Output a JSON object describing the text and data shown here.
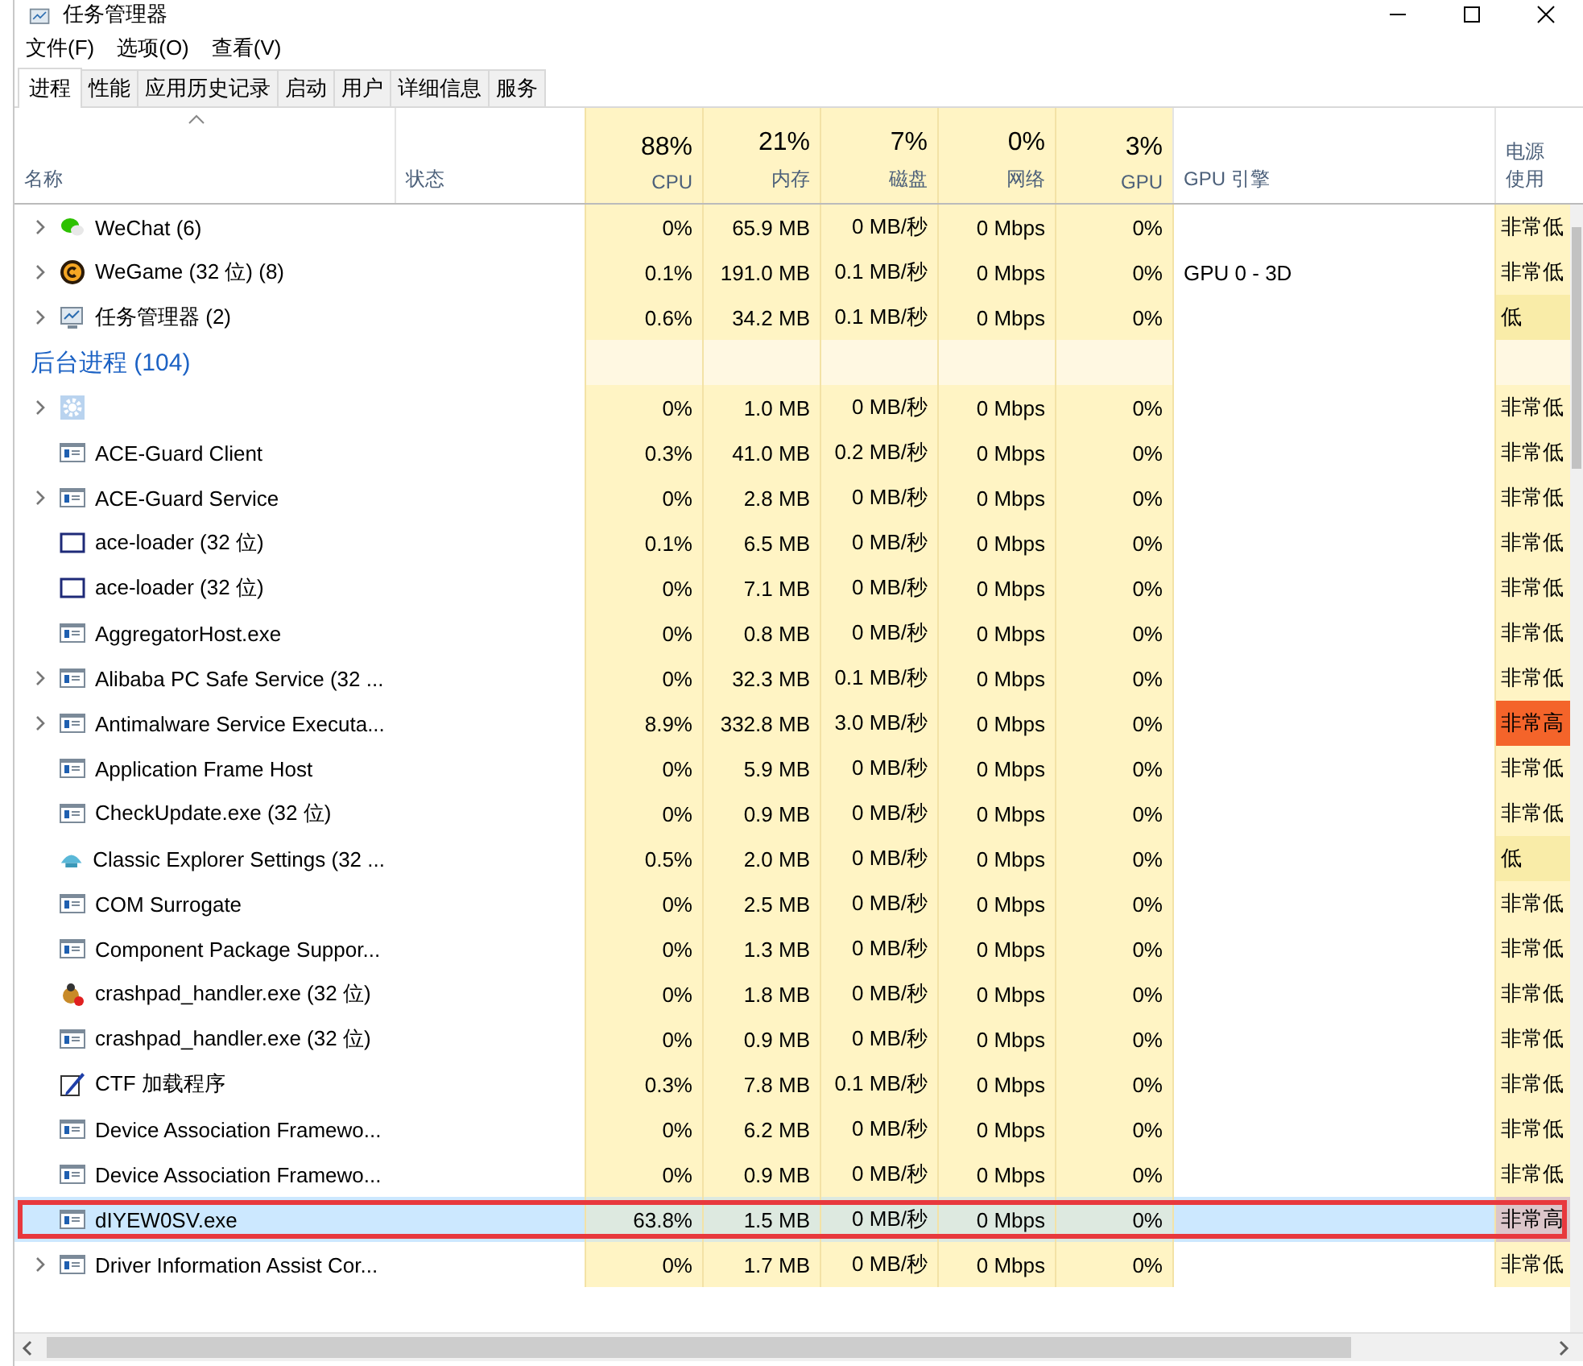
{
  "window": {
    "title": "任务管理器"
  },
  "menu": [
    "文件(F)",
    "选项(O)",
    "查看(V)"
  ],
  "tabs": [
    {
      "label": "进程",
      "selected": true
    },
    {
      "label": "性能",
      "selected": false
    },
    {
      "label": "应用历史记录",
      "selected": false
    },
    {
      "label": "启动",
      "selected": false
    },
    {
      "label": "用户",
      "selected": false
    },
    {
      "label": "详细信息",
      "selected": false
    },
    {
      "label": "服务",
      "selected": false
    }
  ],
  "columns": [
    {
      "label": "名称",
      "sorted": true
    },
    {
      "label": "状态"
    },
    {
      "total": "88%",
      "label": "CPU"
    },
    {
      "total": "21%",
      "label": "内存"
    },
    {
      "total": "7%",
      "label": "磁盘"
    },
    {
      "total": "0%",
      "label": "网络"
    },
    {
      "total": "3%",
      "label": "GPU"
    },
    {
      "label": "GPU 引擎"
    },
    {
      "label": "电源使用"
    }
  ],
  "rows": [
    {
      "kind": "chat",
      "name": "WeChat (6)",
      "expandable": true,
      "selected": false,
      "highlighted": false,
      "values": [
        "0%",
        "65.9 MB",
        "0 MB/秒",
        "0 Mbps",
        "0%"
      ],
      "gpu_engine": "",
      "power": {
        "text": "非常低",
        "color": "#fff4c4"
      }
    },
    {
      "kind": "game",
      "name": "WeGame (32 位) (8)",
      "expandable": true,
      "selected": false,
      "highlighted": false,
      "values": [
        "0.1%",
        "191.0 MB",
        "0.1 MB/秒",
        "0 Mbps",
        "0%"
      ],
      "gpu_engine": "GPU 0 - 3D",
      "power": {
        "text": "非常低",
        "color": "#fff4c4"
      }
    },
    {
      "kind": "monitor",
      "name": "任务管理器 (2)",
      "expandable": true,
      "selected": false,
      "highlighted": false,
      "values": [
        "0.6%",
        "34.2 MB",
        "0.1 MB/秒",
        "0 Mbps",
        "0%"
      ],
      "gpu_engine": "",
      "power": {
        "text": "低",
        "color": "#f9eca8"
      }
    },
    {
      "kind": "group",
      "name": "后台进程 (104)"
    },
    {
      "kind": "gear",
      "name": "",
      "expandable": true,
      "selected": false,
      "highlighted": false,
      "values": [
        "0%",
        "1.0 MB",
        "0 MB/秒",
        "0 Mbps",
        "0%"
      ],
      "gpu_engine": "",
      "power": {
        "text": "非常低",
        "color": "#fff4c4"
      }
    },
    {
      "kind": "app",
      "name": "ACE-Guard Client",
      "expandable": false,
      "selected": false,
      "highlighted": false,
      "values": [
        "0.3%",
        "41.0 MB",
        "0.2 MB/秒",
        "0 Mbps",
        "0%"
      ],
      "gpu_engine": "",
      "power": {
        "text": "非常低",
        "color": "#fff4c4"
      }
    },
    {
      "kind": "app",
      "name": "ACE-Guard Service",
      "expandable": true,
      "selected": false,
      "highlighted": false,
      "values": [
        "0%",
        "2.8 MB",
        "0 MB/秒",
        "0 Mbps",
        "0%"
      ],
      "gpu_engine": "",
      "power": {
        "text": "非常低",
        "color": "#fff4c4"
      }
    },
    {
      "kind": "window",
      "name": "ace-loader (32 位)",
      "expandable": false,
      "selected": false,
      "highlighted": false,
      "values": [
        "0.1%",
        "6.5 MB",
        "0 MB/秒",
        "0 Mbps",
        "0%"
      ],
      "gpu_engine": "",
      "power": {
        "text": "非常低",
        "color": "#fff4c4"
      }
    },
    {
      "kind": "window",
      "name": "ace-loader (32 位)",
      "expandable": false,
      "selected": false,
      "highlighted": false,
      "values": [
        "0%",
        "7.1 MB",
        "0 MB/秒",
        "0 Mbps",
        "0%"
      ],
      "gpu_engine": "",
      "power": {
        "text": "非常低",
        "color": "#fff4c4"
      }
    },
    {
      "kind": "app",
      "name": "AggregatorHost.exe",
      "expandable": false,
      "selected": false,
      "highlighted": false,
      "values": [
        "0%",
        "0.8 MB",
        "0 MB/秒",
        "0 Mbps",
        "0%"
      ],
      "gpu_engine": "",
      "power": {
        "text": "非常低",
        "color": "#fff4c4"
      }
    },
    {
      "kind": "app",
      "name": "Alibaba PC Safe Service (32 ...",
      "expandable": true,
      "selected": false,
      "highlighted": false,
      "values": [
        "0%",
        "32.3 MB",
        "0.1 MB/秒",
        "0 Mbps",
        "0%"
      ],
      "gpu_engine": "",
      "power": {
        "text": "非常低",
        "color": "#fff4c4"
      }
    },
    {
      "kind": "app",
      "name": "Antimalware Service Executa...",
      "expandable": true,
      "selected": false,
      "highlighted": false,
      "values": [
        "8.9%",
        "332.8 MB",
        "3.0 MB/秒",
        "0 Mbps",
        "0%"
      ],
      "gpu_engine": "",
      "power": {
        "text": "非常高",
        "color": "#f4642a"
      }
    },
    {
      "kind": "app",
      "name": "Application Frame Host",
      "expandable": false,
      "selected": false,
      "highlighted": false,
      "values": [
        "0%",
        "5.9 MB",
        "0 MB/秒",
        "0 Mbps",
        "0%"
      ],
      "gpu_engine": "",
      "power": {
        "text": "非常低",
        "color": "#fff4c4"
      }
    },
    {
      "kind": "app",
      "name": "CheckUpdate.exe (32 位)",
      "expandable": false,
      "selected": false,
      "highlighted": false,
      "values": [
        "0%",
        "0.9 MB",
        "0 MB/秒",
        "0 Mbps",
        "0%"
      ],
      "gpu_engine": "",
      "power": {
        "text": "非常低",
        "color": "#fff4c4"
      }
    },
    {
      "kind": "shell",
      "name": "Classic Explorer Settings (32 ...",
      "expandable": false,
      "selected": false,
      "highlighted": false,
      "values": [
        "0.5%",
        "2.0 MB",
        "0 MB/秒",
        "0 Mbps",
        "0%"
      ],
      "gpu_engine": "",
      "power": {
        "text": "低",
        "color": "#f9eca8"
      }
    },
    {
      "kind": "app",
      "name": "COM Surrogate",
      "expandable": false,
      "selected": false,
      "highlighted": false,
      "values": [
        "0%",
        "2.5 MB",
        "0 MB/秒",
        "0 Mbps",
        "0%"
      ],
      "gpu_engine": "",
      "power": {
        "text": "非常低",
        "color": "#fff4c4"
      }
    },
    {
      "kind": "app",
      "name": "Component Package Suppor...",
      "expandable": false,
      "selected": false,
      "highlighted": false,
      "values": [
        "0%",
        "1.3 MB",
        "0 MB/秒",
        "0 Mbps",
        "0%"
      ],
      "gpu_engine": "",
      "power": {
        "text": "非常低",
        "color": "#fff4c4"
      }
    },
    {
      "kind": "bug",
      "name": "crashpad_handler.exe (32 位)",
      "expandable": false,
      "selected": false,
      "highlighted": false,
      "values": [
        "0%",
        "1.8 MB",
        "0 MB/秒",
        "0 Mbps",
        "0%"
      ],
      "gpu_engine": "",
      "power": {
        "text": "非常低",
        "color": "#fff4c4"
      }
    },
    {
      "kind": "app",
      "name": "crashpad_handler.exe (32 位)",
      "expandable": false,
      "selected": false,
      "highlighted": false,
      "values": [
        "0%",
        "0.9 MB",
        "0 MB/秒",
        "0 Mbps",
        "0%"
      ],
      "gpu_engine": "",
      "power": {
        "text": "非常低",
        "color": "#fff4c4"
      }
    },
    {
      "kind": "pen",
      "name": "CTF 加载程序",
      "expandable": false,
      "selected": false,
      "highlighted": false,
      "values": [
        "0.3%",
        "7.8 MB",
        "0.1 MB/秒",
        "0 Mbps",
        "0%"
      ],
      "gpu_engine": "",
      "power": {
        "text": "非常低",
        "color": "#fff4c4"
      }
    },
    {
      "kind": "app",
      "name": "Device Association Framewo...",
      "expandable": false,
      "selected": false,
      "highlighted": false,
      "values": [
        "0%",
        "6.2 MB",
        "0 MB/秒",
        "0 Mbps",
        "0%"
      ],
      "gpu_engine": "",
      "power": {
        "text": "非常低",
        "color": "#fff4c4"
      }
    },
    {
      "kind": "app",
      "name": "Device Association Framewo...",
      "expandable": false,
      "selected": false,
      "highlighted": false,
      "values": [
        "0%",
        "0.9 MB",
        "0 MB/秒",
        "0 Mbps",
        "0%"
      ],
      "gpu_engine": "",
      "power": {
        "text": "非常低",
        "color": "#fff4c4"
      }
    },
    {
      "kind": "app",
      "name": "dIYEW0SV.exe",
      "expandable": false,
      "selected": true,
      "highlighted": true,
      "values": [
        "63.8%",
        "1.5 MB",
        "0 MB/秒",
        "0 Mbps",
        "0%"
      ],
      "gpu_engine": "",
      "power": {
        "text": "非常高",
        "color": "#dcc6ca"
      }
    },
    {
      "kind": "app",
      "name": "Driver Information Assist Cor...",
      "expandable": true,
      "selected": false,
      "highlighted": false,
      "values": [
        "0%",
        "1.7 MB",
        "0 MB/秒",
        "0 Mbps",
        "0%"
      ],
      "gpu_engine": "",
      "power": {
        "text": "非常低",
        "color": "#fff4c4"
      }
    }
  ]
}
